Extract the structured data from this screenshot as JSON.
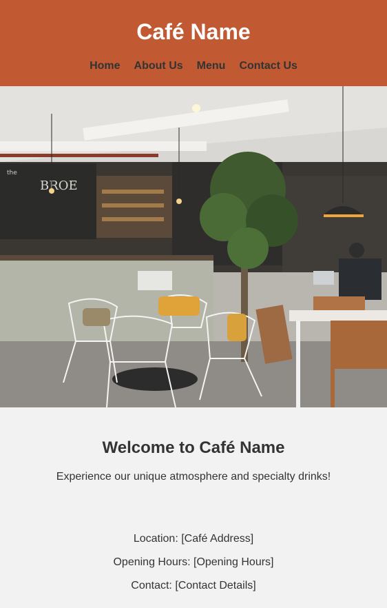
{
  "header": {
    "title": "Café Name",
    "nav": [
      "Home",
      "About Us",
      "Menu",
      "Contact Us"
    ]
  },
  "hero": {
    "image": "cafe-interior-photo"
  },
  "welcome": {
    "title": "Welcome to Café Name",
    "text": "Experience our unique atmosphere and specialty drinks!"
  },
  "info": {
    "location": "Location: [Café Address]",
    "hours": "Opening Hours: [Opening Hours]",
    "contact": "Contact: [Contact Details]"
  },
  "colors": {
    "header_bg": "#c15a33",
    "page_bg": "#f2f2f2",
    "text": "#333333"
  }
}
